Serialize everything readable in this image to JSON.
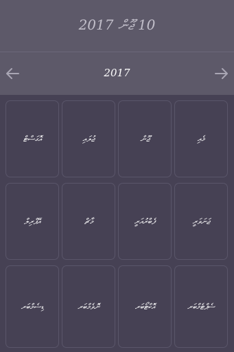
{
  "header": {
    "title": "10 ޖޫން 2017"
  },
  "nav": {
    "year": "2017",
    "prev_icon": "arrow-left-icon",
    "next_icon": "arrow-right-icon"
  },
  "months": [
    "އޮގަސްޓް",
    "ޖުލައި",
    "ޖޫން",
    "މެއި",
    "އޭޕްރިލް",
    "މާޗް",
    "ފެބްރުއަރީ",
    "ޖަނަވަރީ",
    "ޑިސެމްބަރ",
    "ނޮވެމްބަރ",
    "އޮކްޓޯބަރ",
    "ސެޕްޓެމްބަރ"
  ],
  "colors": {
    "header_bg": "#5d5969",
    "grid_bg": "#464154",
    "cell_border": "#5a566a",
    "accent_text": "#ffffff",
    "muted_text": "#c2bfca"
  }
}
